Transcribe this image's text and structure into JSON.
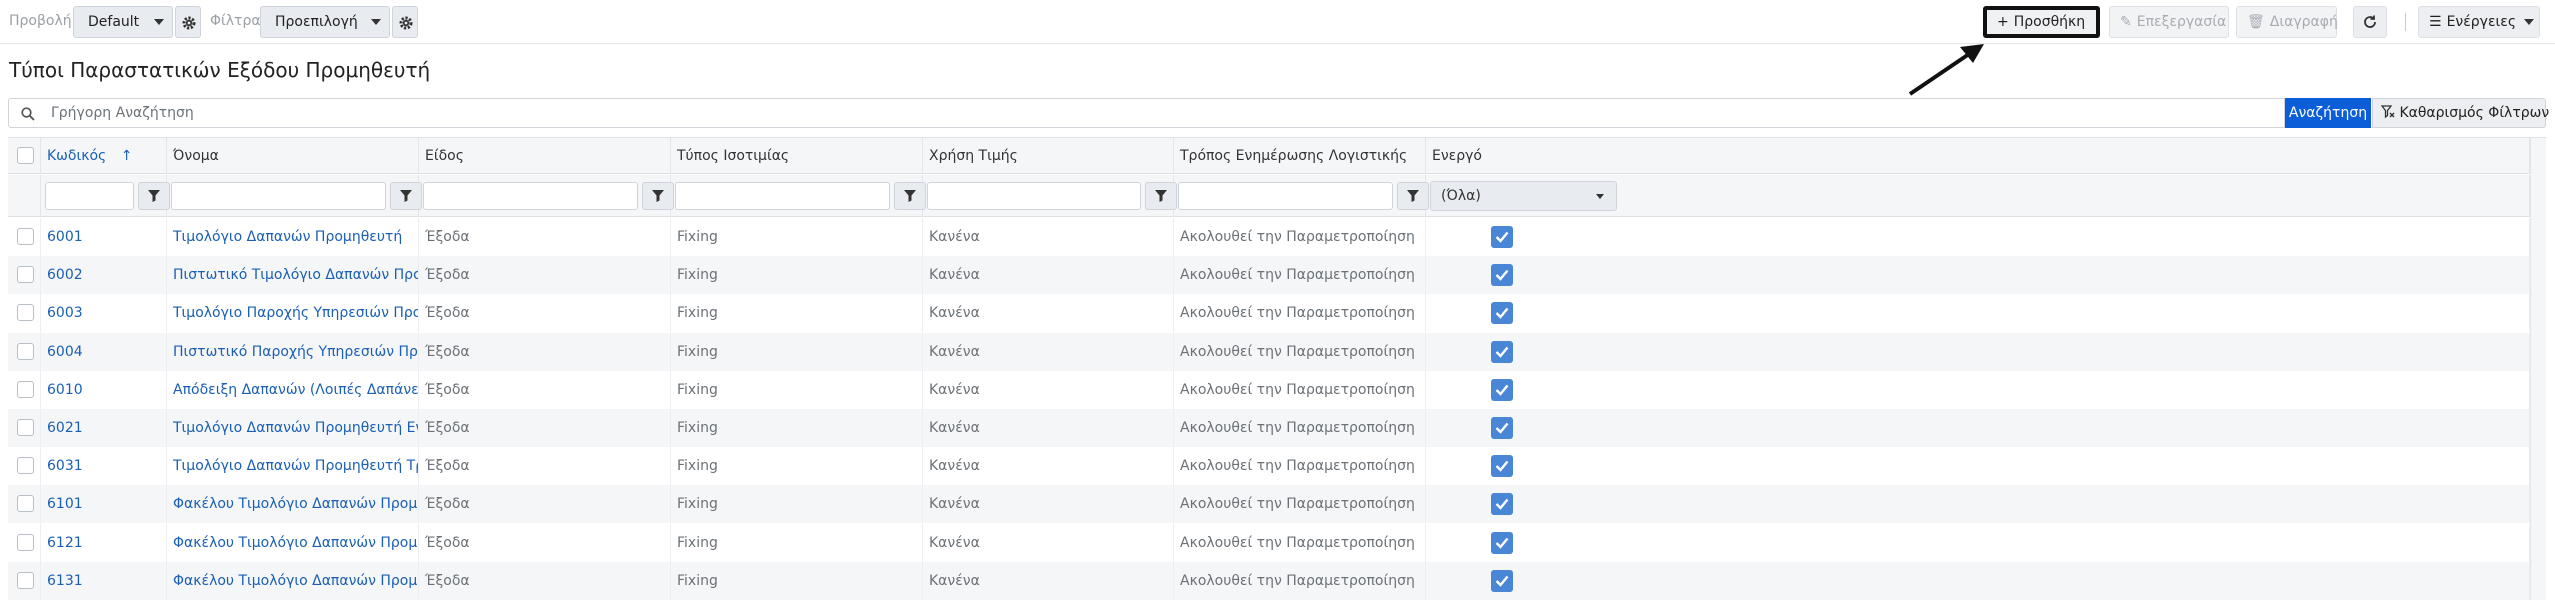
{
  "toolbar": {
    "view_label": "Προβολή",
    "view_value": "Default",
    "filter_label": "Φίλτρα",
    "filter_value": "Προεπιλογή",
    "add_label": "Προσθήκη",
    "edit_label": "Επεξεργασία",
    "delete_label": "Διαγραφή",
    "actions_label": "Ενέργειες"
  },
  "page": {
    "title": "Τύποι Παραστατικών Εξόδου Προμηθευτή"
  },
  "search": {
    "placeholder": "Γρήγορη Αναζήτηση",
    "search_label": "Αναζήτηση",
    "clear_label": "Καθαρισμός Φίλτρων"
  },
  "grid": {
    "columns": [
      "Κωδικός",
      "Όνομα",
      "Είδος",
      "Τύπος Ισοτιμίας",
      "Χρήση Τιμής",
      "Τρόπος Ενημέρωσης Λογιστικής",
      "Ενεργό"
    ],
    "sort_indicator": "↑",
    "active_filter_value": "(Όλα)",
    "rows": [
      {
        "code": "6001",
        "name": "Τιμολόγιο Δαπανών Προμηθευτή",
        "kind": "Έξοδα",
        "rate": "Fixing",
        "price": "Κανένα",
        "accounting": "Ακολουθεί την Παραμετροποίηση",
        "active": true
      },
      {
        "code": "6002",
        "name": "Πιστωτικό Τιμολόγιο Δαπανών Προμηθευτή",
        "kind": "Έξοδα",
        "rate": "Fixing",
        "price": "Κανένα",
        "accounting": "Ακολουθεί την Παραμετροποίηση",
        "active": true
      },
      {
        "code": "6003",
        "name": "Τιμολόγιο Παροχής Υπηρεσιών Προμηθευτή",
        "kind": "Έξοδα",
        "rate": "Fixing",
        "price": "Κανένα",
        "accounting": "Ακολουθεί την Παραμετροποίηση",
        "active": true
      },
      {
        "code": "6004",
        "name": "Πιστωτικό Παροχής Υπηρεσιών Προμηθευτή",
        "kind": "Έξοδα",
        "rate": "Fixing",
        "price": "Κανένα",
        "accounting": "Ακολουθεί την Παραμετροποίηση",
        "active": true
      },
      {
        "code": "6010",
        "name": "Απόδειξη Δαπανών (Λοιπές Δαπάνες)",
        "kind": "Έξοδα",
        "rate": "Fixing",
        "price": "Κανένα",
        "accounting": "Ακολουθεί την Παραμετροποίηση",
        "active": true
      },
      {
        "code": "6021",
        "name": "Τιμολόγιο Δαπανών Προμηθευτή Ενδοκοινοτικό",
        "kind": "Έξοδα",
        "rate": "Fixing",
        "price": "Κανένα",
        "accounting": "Ακολουθεί την Παραμετροποίηση",
        "active": true
      },
      {
        "code": "6031",
        "name": "Τιμολόγιο Δαπανών Προμηθευτή Τρίτων Χωρών",
        "kind": "Έξοδα",
        "rate": "Fixing",
        "price": "Κανένα",
        "accounting": "Ακολουθεί την Παραμετροποίηση",
        "active": true
      },
      {
        "code": "6101",
        "name": "Φακέλου Τιμολόγιο Δαπανών Προμηθευτή",
        "kind": "Έξοδα",
        "rate": "Fixing",
        "price": "Κανένα",
        "accounting": "Ακολουθεί την Παραμετροποίηση",
        "active": true
      },
      {
        "code": "6121",
        "name": "Φακέλου Τιμολόγιο Δαπανών Προμηθευτή Ενδοκοινοτικό",
        "kind": "Έξοδα",
        "rate": "Fixing",
        "price": "Κανένα",
        "accounting": "Ακολουθεί την Παραμετροποίηση",
        "active": true
      },
      {
        "code": "6131",
        "name": "Φακέλου Τιμολόγιο Δαπανών Προμηθευτή Τρίτων Χωρών",
        "kind": "Έξοδα",
        "rate": "Fixing",
        "price": "Κανένα",
        "accounting": "Ακολουθεί την Παραμετροποίηση",
        "active": true
      }
    ]
  },
  "icons": {
    "gear": "gear-icon",
    "plus": "plus-icon",
    "pencil": "pencil-icon",
    "trash": "trash-icon",
    "refresh": "refresh-icon",
    "menu": "menu-icon",
    "search": "search-icon",
    "filter": "filter-icon",
    "clear_filter": "filter-clear-icon",
    "check": "check-icon"
  },
  "colors": {
    "accent": "#0b5ed7",
    "link": "#1a5fb4",
    "checkbox_on": "#4a86d6"
  }
}
